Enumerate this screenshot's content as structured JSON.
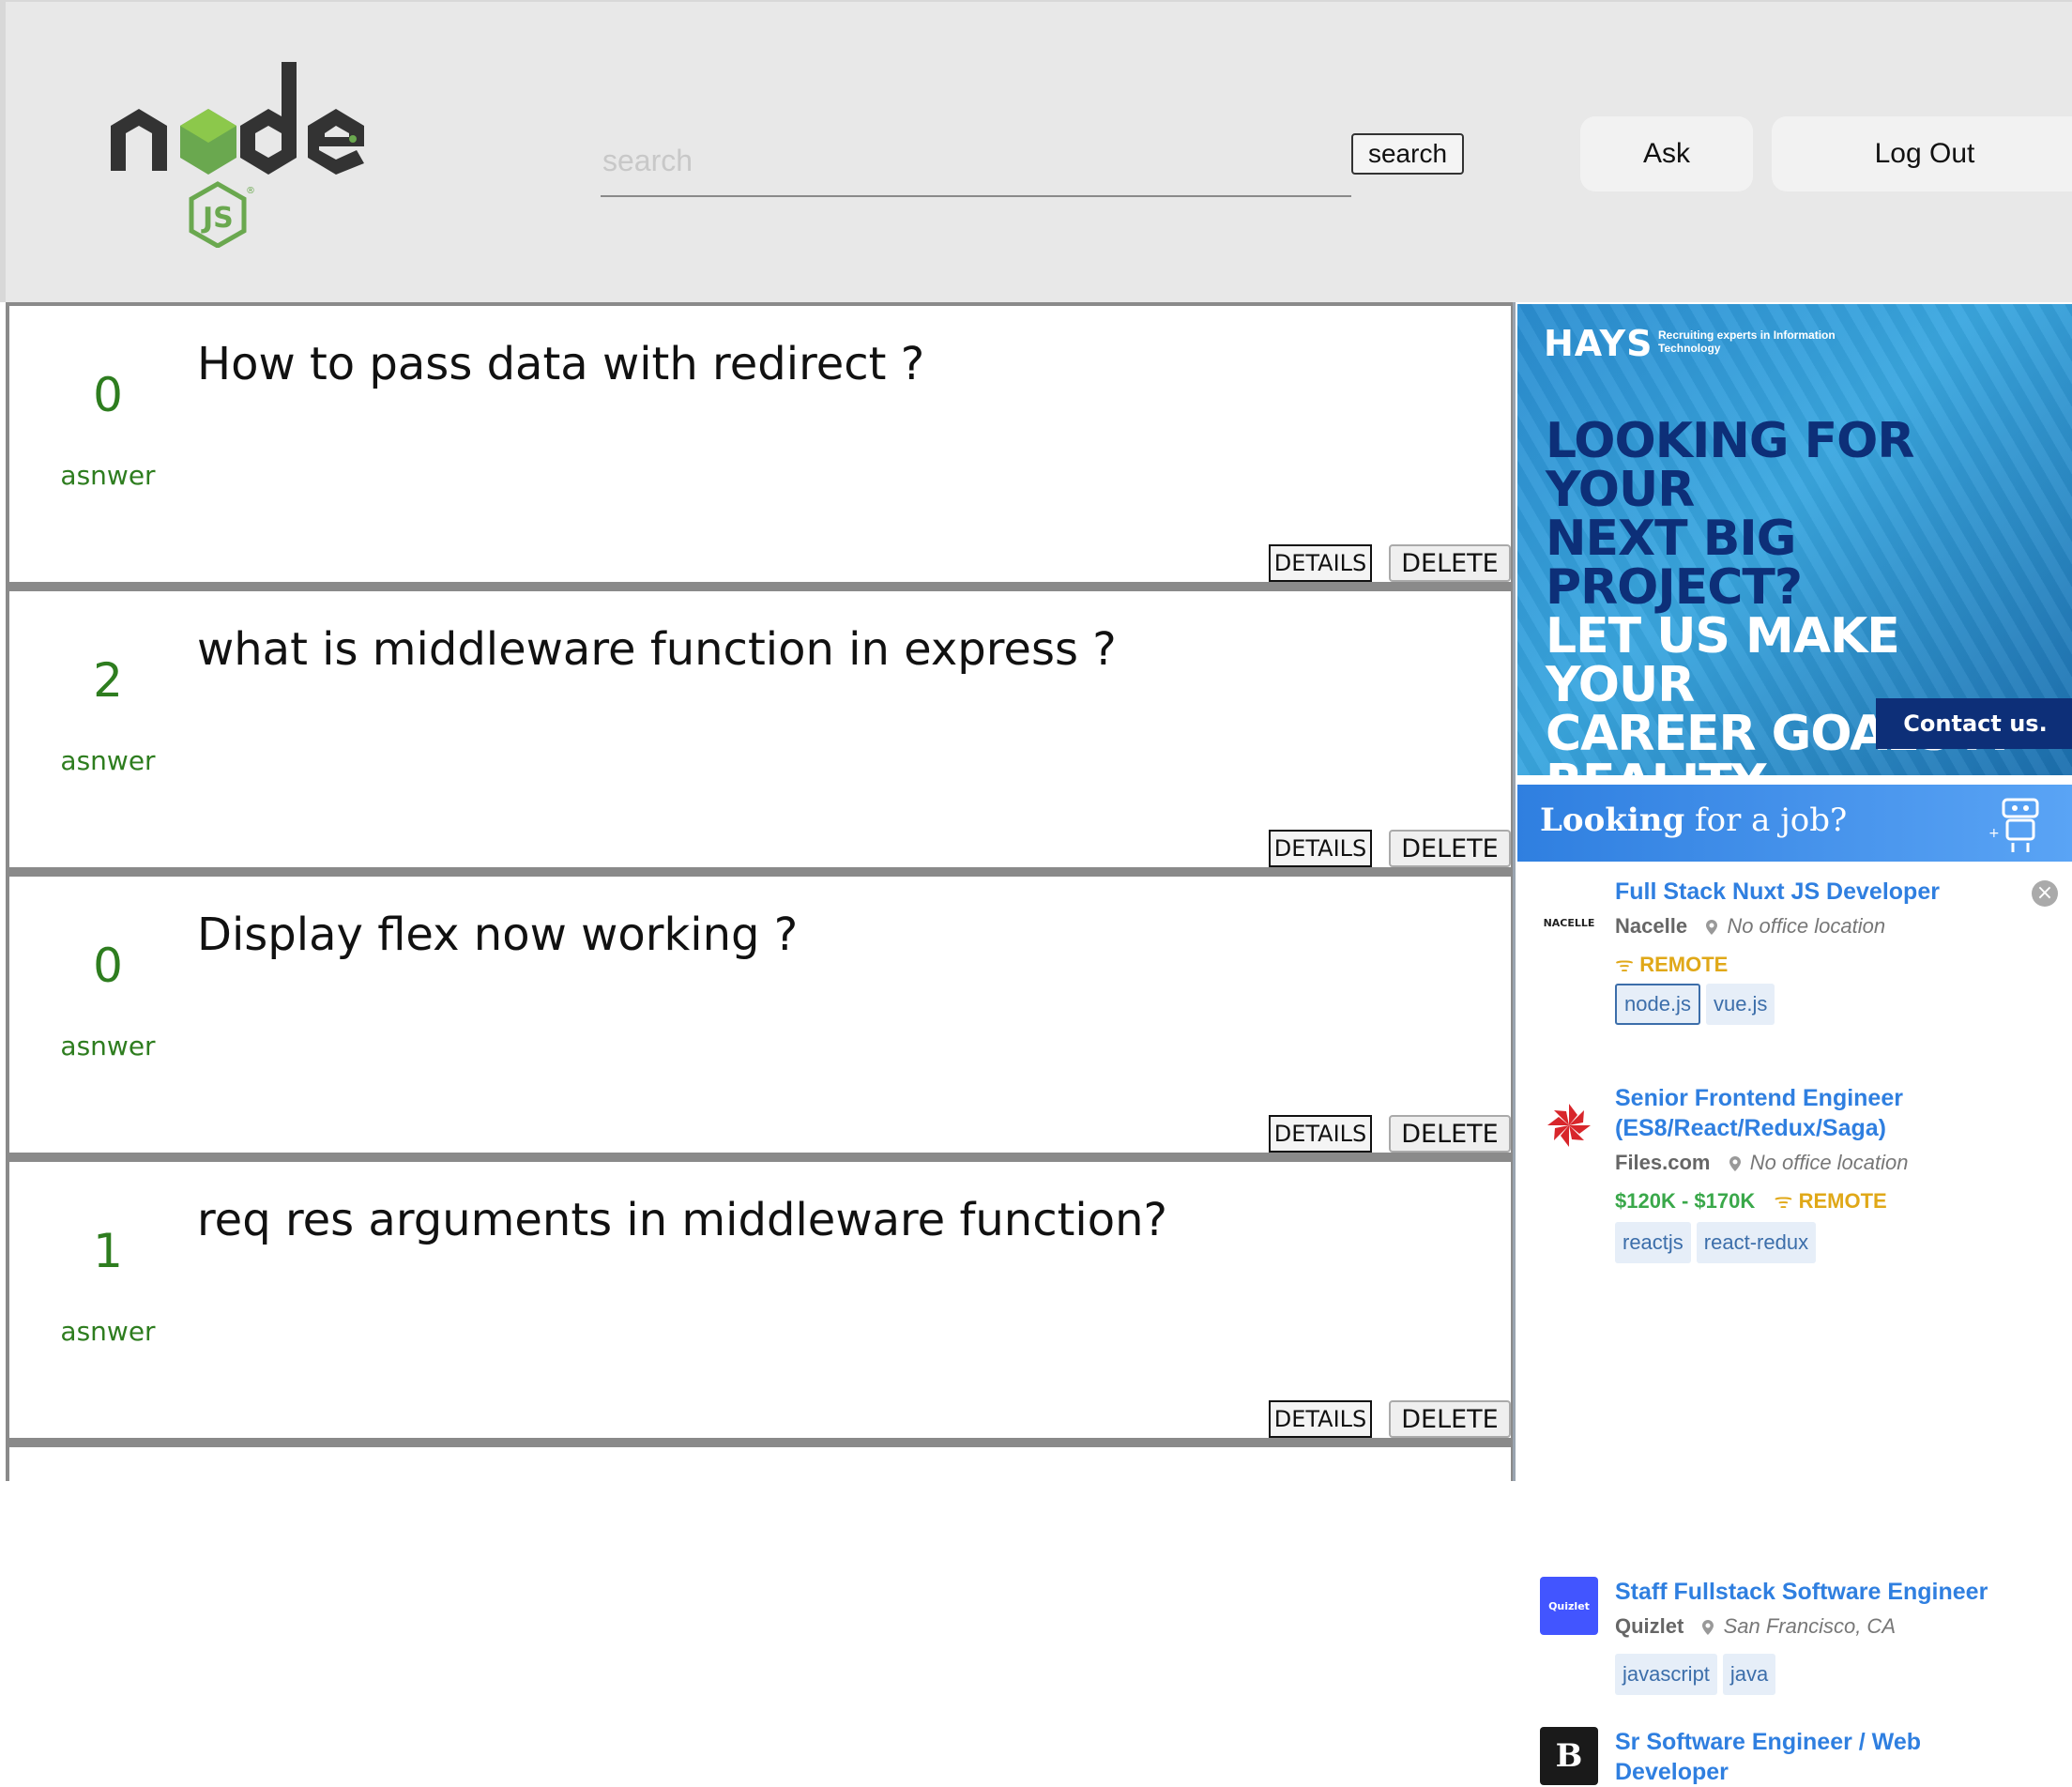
{
  "header": {
    "logo_alt": "node js",
    "search_placeholder": "search",
    "search_button": "search",
    "ask_button": "Ask",
    "logout_button": "Log Out"
  },
  "questions": [
    {
      "count": "0",
      "count_label": "asnwer",
      "title": "How to pass data with redirect ?",
      "details": "DETAILS",
      "delete": "DELETE"
    },
    {
      "count": "2",
      "count_label": "asnwer",
      "title": "what is middleware function in express ?",
      "details": "DETAILS",
      "delete": "DELETE"
    },
    {
      "count": "0",
      "count_label": "asnwer",
      "title": "Display flex now working ?",
      "details": "DETAILS",
      "delete": "DELETE"
    },
    {
      "count": "1",
      "count_label": "asnwer",
      "title": "req res arguments in middleware function?",
      "details": "DETAILS",
      "delete": "DELETE"
    }
  ],
  "ad_hays": {
    "logo": "HAYS",
    "tagline": "Recruiting experts in Information Technology",
    "headline_dark_1": "LOOKING FOR YOUR",
    "headline_dark_2": "NEXT BIG PROJECT?",
    "headline_light_1": "LET US MAKE YOUR",
    "headline_light_2": "CAREER GOALS A",
    "headline_light_3": "REALITY.",
    "contact": "Contact us.",
    "colors": {
      "dark": "#0d2f78",
      "bg": "#3aa7e0"
    }
  },
  "jobs": {
    "heading_bold": "Looking",
    "heading_rest": " for a job?",
    "items": [
      {
        "logo_text": "NACELLE",
        "title": "Full Stack Nuxt JS Developer",
        "company": "Nacelle",
        "location": "No office location",
        "salary": "",
        "remote": "REMOTE",
        "tags": [
          "node.js",
          "vue.js"
        ]
      },
      {
        "logo_text": "",
        "title": "Senior Frontend Engineer (ES8/React/Redux/Saga)",
        "company": "Files.com",
        "location": "No office location",
        "salary": "$120K - $170K",
        "remote": "REMOTE",
        "tags": [
          "reactjs",
          "react-redux"
        ]
      },
      {
        "logo_text": "Quizlet",
        "title": "Staff Fullstack Software Engineer",
        "company": "Quizlet",
        "location": "San Francisco, CA",
        "salary": "",
        "remote": "",
        "tags": [
          "javascript",
          "java"
        ]
      },
      {
        "logo_text": "B",
        "title": "Sr Software Engineer / Web Developer",
        "company": "",
        "location": "",
        "salary": "",
        "remote": "",
        "tags": []
      }
    ]
  }
}
